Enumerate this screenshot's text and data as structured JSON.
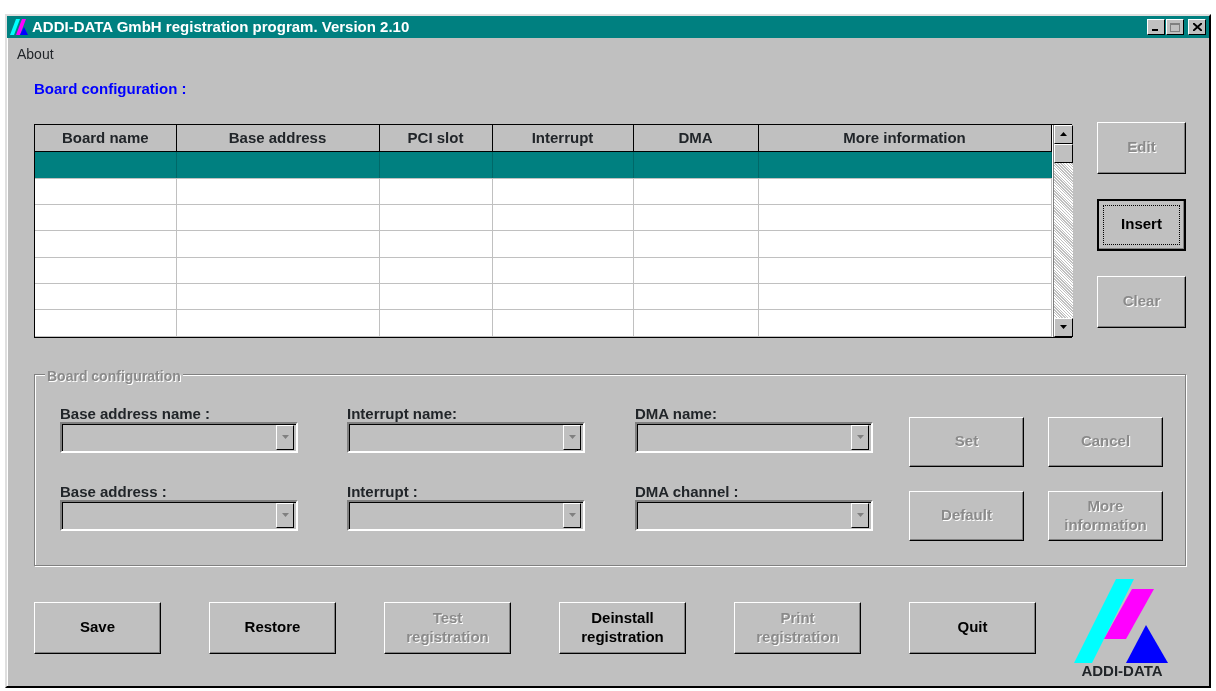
{
  "window": {
    "title": "ADDI-DATA GmbH registration program. Version 2.10",
    "controls": [
      {
        "kind": "minimize",
        "disabled": false
      },
      {
        "kind": "maximize",
        "disabled": true
      },
      {
        "kind": "close",
        "disabled": false
      }
    ]
  },
  "menu": [
    {
      "label": "About"
    }
  ],
  "section_title": "Board configuration :",
  "table": {
    "columns": [
      "Board name",
      "Base address",
      "PCI slot",
      "Interrupt",
      "DMA",
      "More information"
    ],
    "rows": [
      {
        "selected": true
      },
      {
        "selected": false
      },
      {
        "selected": false
      },
      {
        "selected": false
      },
      {
        "selected": false
      },
      {
        "selected": false
      },
      {
        "selected": false
      }
    ]
  },
  "side_buttons": [
    {
      "label": "Edit",
      "disabled": true,
      "default": false
    },
    {
      "label": "Insert",
      "disabled": false,
      "default": true
    },
    {
      "label": "Clear",
      "disabled": true,
      "default": false
    }
  ],
  "group": {
    "title": "Board configuration",
    "disabled": true,
    "fields": [
      {
        "label": "Base address name :",
        "disabled": true
      },
      {
        "label": "Interrupt name:",
        "disabled": true
      },
      {
        "label": "DMA name:",
        "disabled": true
      },
      {
        "label": "Base address :",
        "disabled": true
      },
      {
        "label": "Interrupt :",
        "disabled": true
      },
      {
        "label": "DMA channel :",
        "disabled": true
      }
    ],
    "buttons": [
      {
        "label": "Set",
        "disabled": true
      },
      {
        "label": "Cancel",
        "disabled": true
      },
      {
        "label": "Default",
        "disabled": true
      },
      {
        "label": "More information",
        "disabled": true
      }
    ]
  },
  "bottom_buttons": [
    {
      "label": "Save",
      "disabled": false
    },
    {
      "label": "Restore",
      "disabled": false
    },
    {
      "label": "Test registration",
      "disabled": true
    },
    {
      "label": "Deinstall registration",
      "disabled": false
    },
    {
      "label": "Print registration",
      "disabled": true
    },
    {
      "label": "Quit",
      "disabled": false
    }
  ],
  "logo": {
    "text": "ADDI-DATA"
  }
}
